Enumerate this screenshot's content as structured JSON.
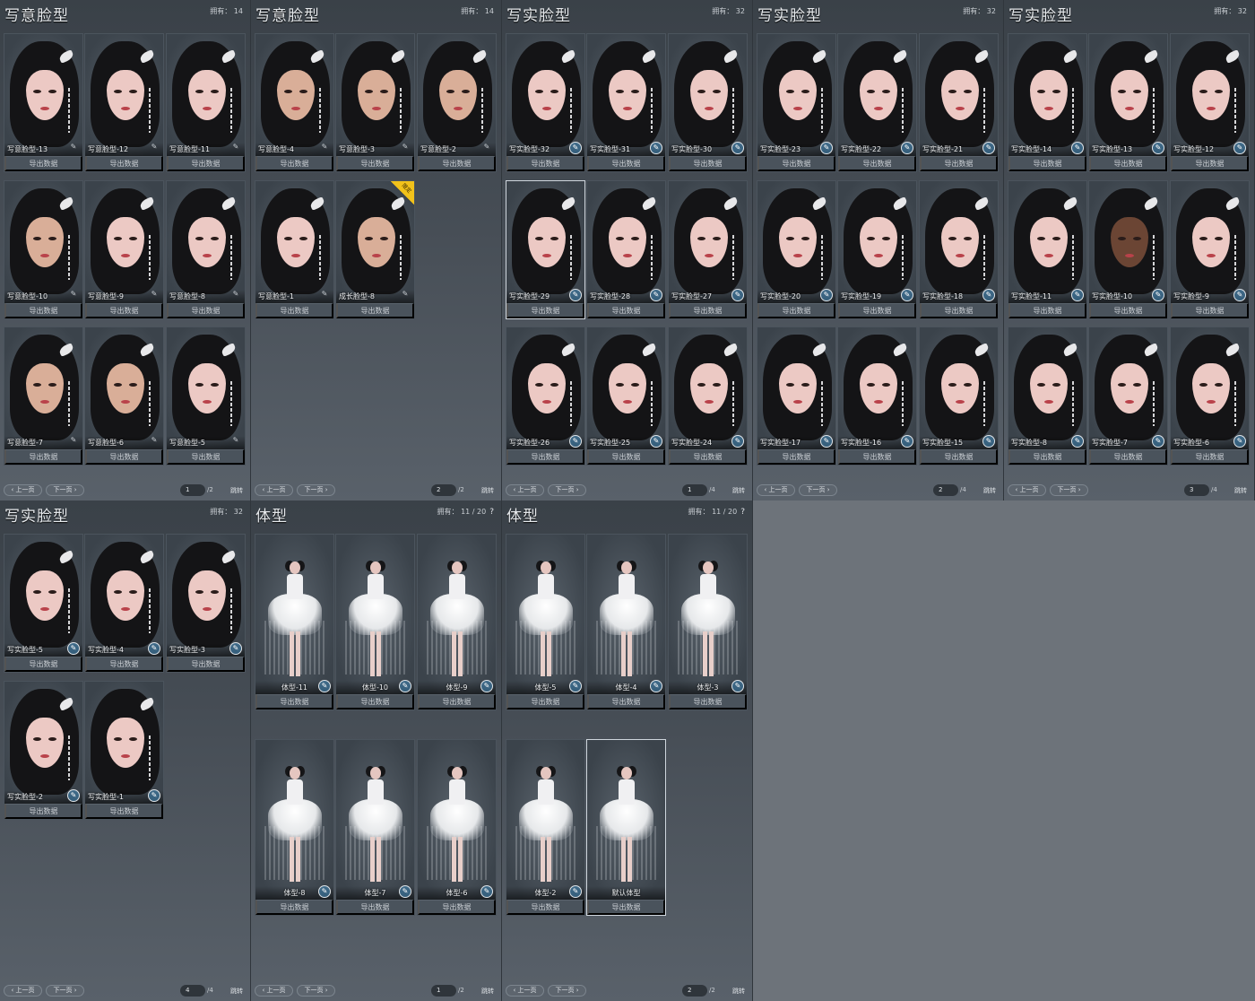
{
  "export_label": "导出数据",
  "pager": {
    "prev": "‹ 上一页",
    "next": "下一页 ›",
    "jump": "跳转"
  },
  "panels": [
    {
      "title": "写意脸型",
      "count": "拥有： 14",
      "help": "",
      "page": "1",
      "total": "/2",
      "kind": "face",
      "cards": [
        {
          "name": "写意脸型-13",
          "tone": "light"
        },
        {
          "name": "写意脸型-12",
          "tone": "light"
        },
        {
          "name": "写意脸型-11",
          "tone": "light"
        },
        {
          "name": "写意脸型-10",
          "tone": "tan"
        },
        {
          "name": "写意脸型-9",
          "tone": "light"
        },
        {
          "name": "写意脸型-8",
          "tone": "light"
        },
        {
          "name": "写意脸型-7",
          "tone": "tan"
        },
        {
          "name": "写意脸型-6",
          "tone": "tan"
        },
        {
          "name": "写意脸型-5",
          "tone": "light"
        }
      ]
    },
    {
      "title": "写意脸型",
      "count": "拥有： 14",
      "help": "",
      "page": "2",
      "total": "/2",
      "kind": "face",
      "cards": [
        {
          "name": "写意脸型-4",
          "tone": "tan"
        },
        {
          "name": "写意脸型-3",
          "tone": "tan"
        },
        {
          "name": "写意脸型-2",
          "tone": "tan"
        },
        {
          "name": "写意脸型-1",
          "tone": "light"
        },
        {
          "name": "成长脸型-8",
          "tone": "tan",
          "badge": "限定"
        }
      ]
    },
    {
      "title": "写实脸型",
      "count": "拥有： 32",
      "help": "",
      "page": "1",
      "total": "/4",
      "kind": "face",
      "cards": [
        {
          "name": "写实脸型-32",
          "tone": "light"
        },
        {
          "name": "写实脸型-31",
          "tone": "light"
        },
        {
          "name": "写实脸型-30",
          "tone": "light"
        },
        {
          "name": "写实脸型-29",
          "tone": "light",
          "selected": true
        },
        {
          "name": "写实脸型-28",
          "tone": "light"
        },
        {
          "name": "写实脸型-27",
          "tone": "light"
        },
        {
          "name": "写实脸型-26",
          "tone": "light"
        },
        {
          "name": "写实脸型-25",
          "tone": "light"
        },
        {
          "name": "写实脸型-24",
          "tone": "light"
        }
      ]
    },
    {
      "title": "写实脸型",
      "count": "拥有： 32",
      "help": "",
      "page": "2",
      "total": "/4",
      "kind": "face",
      "cards": [
        {
          "name": "写实脸型-23",
          "tone": "light"
        },
        {
          "name": "写实脸型-22",
          "tone": "light"
        },
        {
          "name": "写实脸型-21",
          "tone": "light"
        },
        {
          "name": "写实脸型-20",
          "tone": "light"
        },
        {
          "name": "写实脸型-19",
          "tone": "light"
        },
        {
          "name": "写实脸型-18",
          "tone": "light"
        },
        {
          "name": "写实脸型-17",
          "tone": "light"
        },
        {
          "name": "写实脸型-16",
          "tone": "light"
        },
        {
          "name": "写实脸型-15",
          "tone": "light"
        }
      ]
    },
    {
      "title": "写实脸型",
      "count": "拥有： 32",
      "help": "",
      "page": "3",
      "total": "/4",
      "kind": "face",
      "cards": [
        {
          "name": "写实脸型-14",
          "tone": "light"
        },
        {
          "name": "写实脸型-13",
          "tone": "light"
        },
        {
          "name": "写实脸型-12",
          "tone": "light"
        },
        {
          "name": "写实脸型-11",
          "tone": "light"
        },
        {
          "name": "写实脸型-10",
          "tone": "dark"
        },
        {
          "name": "写实脸型-9",
          "tone": "light"
        },
        {
          "name": "写实脸型-8",
          "tone": "light"
        },
        {
          "name": "写实脸型-7",
          "tone": "light"
        },
        {
          "name": "写实脸型-6",
          "tone": "light"
        }
      ]
    },
    {
      "title": "写实脸型",
      "count": "拥有： 32",
      "help": "",
      "page": "4",
      "total": "/4",
      "kind": "face",
      "cards": [
        {
          "name": "写实脸型-5",
          "tone": "light"
        },
        {
          "name": "写实脸型-4",
          "tone": "light"
        },
        {
          "name": "写实脸型-3",
          "tone": "light"
        },
        {
          "name": "写实脸型-2",
          "tone": "light"
        },
        {
          "name": "写实脸型-1",
          "tone": "light"
        }
      ]
    },
    {
      "title": "体型",
      "count": "拥有： 11 / 20",
      "help": "?",
      "page": "1",
      "total": "/2",
      "kind": "body",
      "cards": [
        {
          "name": "体型-11"
        },
        {
          "name": "体型-10"
        },
        {
          "name": "体型-9"
        },
        {
          "name": "体型-8"
        },
        {
          "name": "体型-7"
        },
        {
          "name": "体型-6"
        }
      ]
    },
    {
      "title": "体型",
      "count": "拥有： 11 / 20",
      "help": "?",
      "page": "2",
      "total": "/2",
      "kind": "body",
      "cards": [
        {
          "name": "体型-5"
        },
        {
          "name": "体型-4"
        },
        {
          "name": "体型-3"
        },
        {
          "name": "体型-2"
        },
        {
          "name": "默认体型",
          "selected": true
        }
      ]
    }
  ]
}
